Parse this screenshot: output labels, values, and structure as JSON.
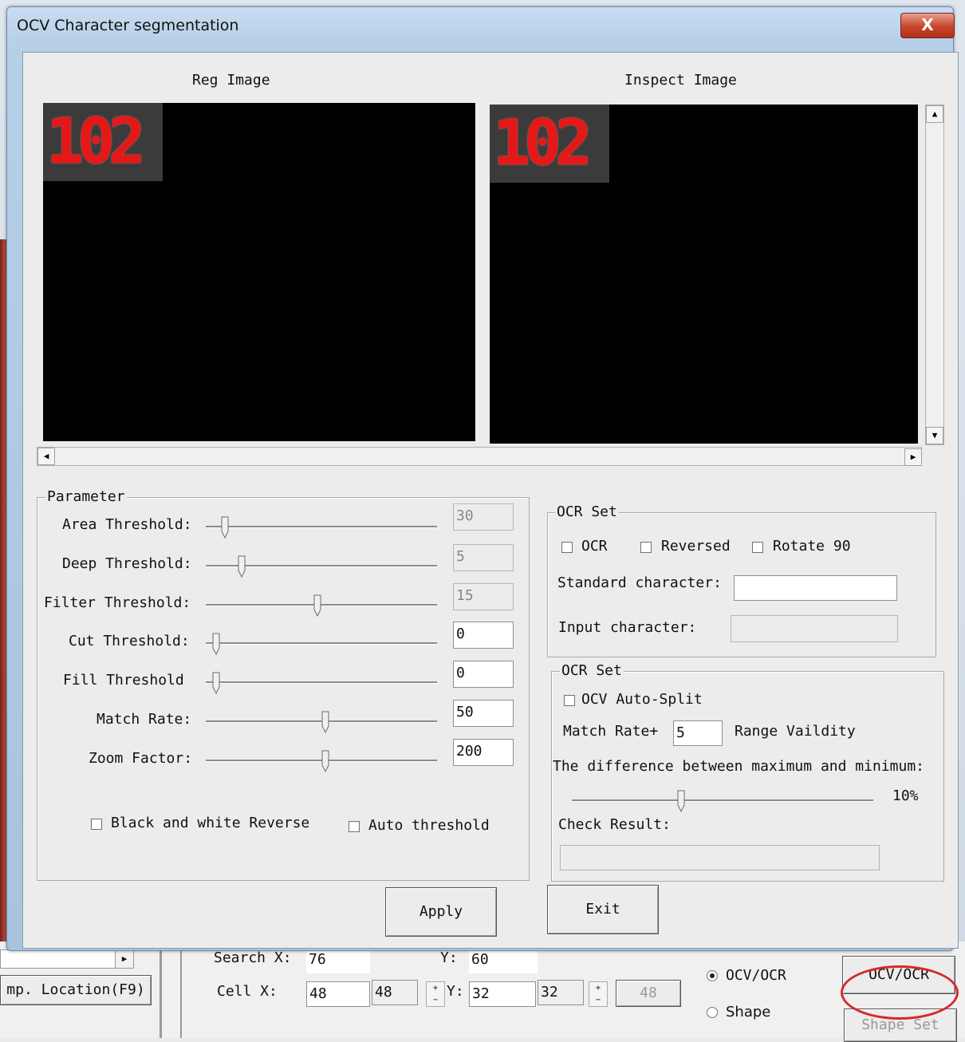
{
  "window": {
    "title": "OCV Character segmentation",
    "close_glyph": "X"
  },
  "images": {
    "reg_label": "Reg Image",
    "inspect_label": "Inspect Image",
    "reg_text": "102",
    "inspect_text": "102"
  },
  "parameter": {
    "title": "Parameter",
    "rows": [
      {
        "label": "Area Threshold:",
        "value": "30",
        "disabled": true,
        "level": 0.04
      },
      {
        "label": "Deep Threshold:",
        "value": "5",
        "disabled": true,
        "level": 0.12
      },
      {
        "label": "Filter Threshold:",
        "value": "15",
        "disabled": true,
        "level": 0.48
      },
      {
        "label": "Cut Threshold:",
        "value": "0",
        "disabled": false,
        "level": 0.0
      },
      {
        "label": "Fill Threshold",
        "value": "0",
        "disabled": false,
        "level": 0.0
      },
      {
        "label": "Match Rate:",
        "value": "50",
        "disabled": false,
        "level": 0.52
      },
      {
        "label": "Zoom Factor:",
        "value": "200",
        "disabled": false,
        "level": 0.52
      }
    ],
    "bw_reverse": "Black and white Reverse",
    "auto_threshold": "Auto threshold"
  },
  "ocr_set": {
    "title": "OCR Set",
    "ocr": "OCR",
    "reversed": "Reversed",
    "rotate": "Rotate 90",
    "standard_label": "Standard character:",
    "standard_value": "",
    "input_label": "Input character:",
    "input_value": ""
  },
  "ocv_set": {
    "title": "OCR Set",
    "auto_split": "OCV Auto-Split",
    "match_rate_label": "Match Rate+",
    "match_rate_value": "5",
    "range_label": "Range Vaildity",
    "diff_label": "The difference between maximum and minimum:",
    "diff_value": "10%",
    "diff_level": 0.35,
    "check_label": "Check Result:",
    "check_value": ""
  },
  "buttons": {
    "apply": "Apply",
    "exit": "Exit"
  },
  "background": {
    "search_x_label": "Search X:",
    "search_x": "76",
    "y_label": "Y:",
    "search_y": "60",
    "cell_x_label": "Cell X:",
    "cell_x": "48",
    "cell_x2": "48",
    "cell_y_label": "Y:",
    "cell_y": "32",
    "cell_y2": "32",
    "cell_w": "48",
    "location_button": "mp. Location(F9)",
    "radio_ocv": "OCV/OCR",
    "radio_shape": "Shape",
    "ocv_button": "OCV/OCR",
    "shape_set": "Shape Set",
    "highlight_color": "#d42a2a"
  }
}
